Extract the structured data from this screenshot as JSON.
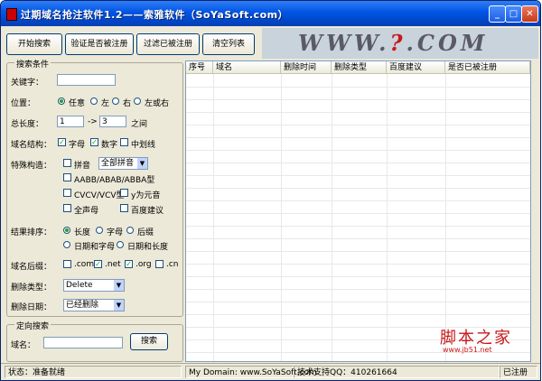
{
  "window": {
    "title": "过期域名抢注软件1.2——索雅软件（SoYaSoft.com）"
  },
  "toolbar": {
    "start_search": "开始搜索",
    "verify": "验证是否被注册",
    "filter": "过滤已被注册",
    "clear": "清空列表"
  },
  "banner": {
    "text_left": "WWW.",
    "text_mid": "?",
    "text_right": ".COM"
  },
  "search_conditions": {
    "legend": "搜索条件",
    "keyword_label": "关键字：",
    "keyword_value": "",
    "position_label": "位置：",
    "position_options": [
      "任意",
      "左",
      "右",
      "左或右"
    ],
    "position_selected": "任意",
    "length_label": "总长度：",
    "length_from": "1",
    "length_sep": "->",
    "length_to": "3",
    "length_suffix": "之间",
    "structure_label": "域名结构：",
    "structure_letters": "字母",
    "structure_digits": "数字",
    "structure_hyphen": "中划线",
    "special_label": "特殊构造：",
    "pinyin": "拼音",
    "pinyin_select": "全部拼音",
    "aabb": "AABB/ABAB/ABBA型",
    "cvcv": "CVCV/VCV型",
    "y_vowel": "y为元音",
    "all_consonants": "全声母",
    "baidu_suggest": "百度建议",
    "sort_label": "结果排序：",
    "sort_options": [
      "长度",
      "字母",
      "后缀",
      "日期和字母",
      "日期和长度"
    ],
    "sort_selected": "长度",
    "suffix_label": "域名后缀：",
    "suffixes": [
      ".com",
      ".net",
      ".org",
      ".cn"
    ],
    "delete_type_label": "删除类型：",
    "delete_type_value": "Delete",
    "delete_date_label": "删除日期：",
    "delete_date_value": "已经删除"
  },
  "directed_search": {
    "legend": "定向搜索",
    "domain_label": "域名：",
    "domain_value": "",
    "search_button": "搜索"
  },
  "grid": {
    "columns": [
      "序号",
      "域名",
      "删除时间",
      "删除类型",
      "百度建议",
      "是否已被注册"
    ]
  },
  "statusbar": {
    "status": "状态：准备就绪",
    "domain": "My Domain: www.SoYaSoft.com",
    "qq": "技术支持QQ：410261664",
    "registered": "已注册"
  },
  "watermark": {
    "text": "脚本之家",
    "url": "www.jb51.net"
  }
}
